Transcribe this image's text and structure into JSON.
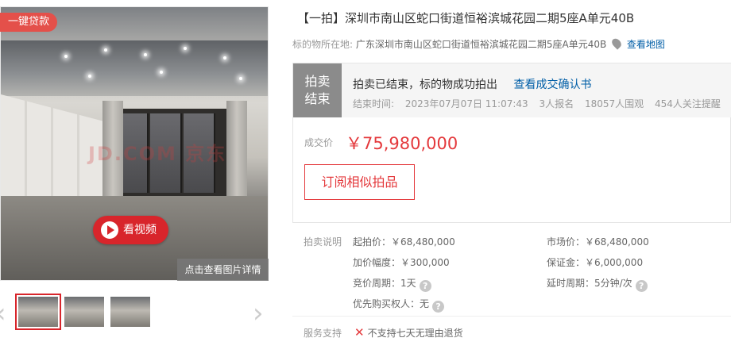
{
  "gallery": {
    "loan_badge": "一键贷款",
    "watermark": "JD.COM 京东",
    "video_button": "看视频",
    "detail_link": "点击查看图片详情",
    "prev_arrow": "‹",
    "next_arrow": "›",
    "thumbnails": [
      "thumb-1",
      "thumb-2",
      "thumb-3"
    ]
  },
  "item": {
    "title": "【一拍】深圳市南山区蛇口街道恒裕滨城花园二期5座A单元40B",
    "location_label": "标的物所在地:",
    "location_address": "广东深圳市南山区蛇口街道恒裕滨城花园二期5座A单元40B",
    "map_link": "查看地图"
  },
  "status": {
    "block_line1": "拍卖",
    "block_line2": "结束",
    "message": "拍卖已结束，标的物成功拍出",
    "confirm_link": "查看成交确认书",
    "end_time_label": "结束时间:",
    "end_time": "2023年07月07日 11:07:43",
    "signups": "3人报名",
    "watchers": "18057人围观",
    "reminders": "454人关注提醒"
  },
  "deal": {
    "price_label": "成交价",
    "price_value": "￥75,980,000",
    "subscribe_button": "订阅相似拍品"
  },
  "rules": {
    "label": "拍卖说明",
    "starting_price": "起拍价：￥68,480,000",
    "market_price": "市场价：￥68,480,000",
    "increment": "加价幅度：￥300,000",
    "deposit": "保证金：￥6,000,000",
    "bid_period": "竞价周期：1天",
    "extension_period": "延时周期：5分钟/次",
    "priority_buyer": "优先购买权人：无"
  },
  "service": {
    "label": "服务支持",
    "text": "不支持七天无理由退货"
  },
  "colors": {
    "accent_red": "#e4393c",
    "link_blue": "#005ea7",
    "status_gray": "#8b8b8b"
  }
}
